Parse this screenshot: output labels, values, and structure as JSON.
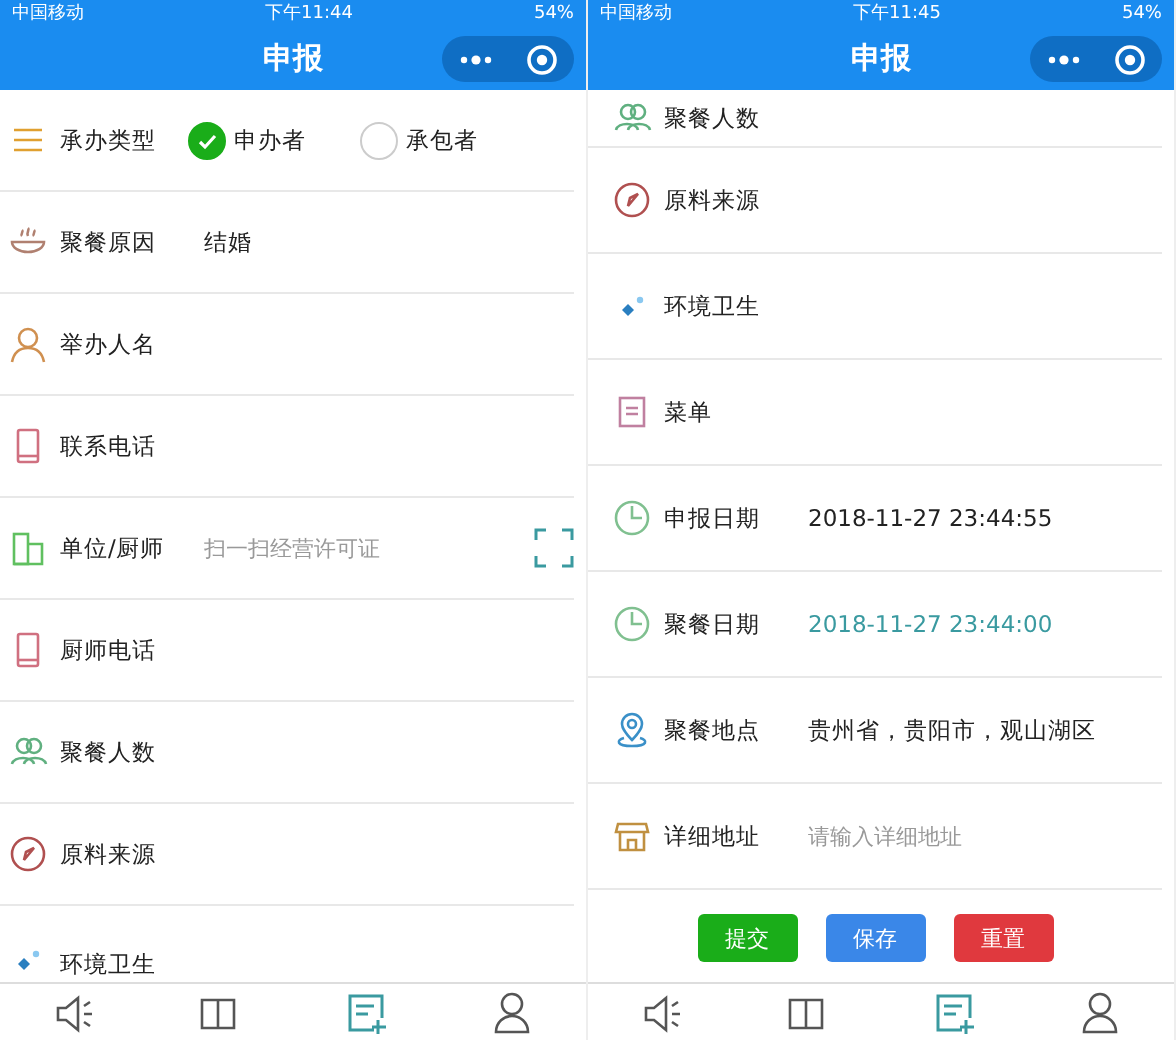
{
  "screens": [
    {
      "status_bar": {
        "carrier": "中国移动",
        "time": "下午11:44",
        "battery": "54%"
      },
      "title": "申报",
      "form_rows": [
        {
          "kind": "radio",
          "label": "承办类型",
          "options": [
            {
              "label": "申办者",
              "selected": true
            },
            {
              "label": "承包者",
              "selected": false
            }
          ]
        },
        {
          "kind": "value",
          "label": "聚餐原因",
          "value": "结婚"
        },
        {
          "kind": "value",
          "label": "举办人名"
        },
        {
          "kind": "value",
          "label": "联系电话"
        },
        {
          "kind": "scan",
          "label": "单位/厨师",
          "placeholder": "扫一扫经营许可证"
        },
        {
          "kind": "value",
          "label": "厨师电话"
        },
        {
          "kind": "value",
          "label": "聚餐人数"
        },
        {
          "kind": "value",
          "label": "原料来源"
        },
        {
          "kind": "value",
          "label": "环境卫生"
        }
      ],
      "tab_bar": [
        {
          "selected": false
        },
        {
          "selected": false
        },
        {
          "selected": true
        },
        {
          "selected": false
        }
      ]
    },
    {
      "status_bar": {
        "carrier": "中国移动",
        "time": "下午11:45",
        "battery": "54%"
      },
      "title": "申报",
      "form_rows": [
        {
          "kind": "value",
          "label": "聚餐人数"
        },
        {
          "kind": "value",
          "label": "原料来源"
        },
        {
          "kind": "value",
          "label": "环境卫生"
        },
        {
          "kind": "value",
          "label": "菜单"
        },
        {
          "kind": "value",
          "label": "申报日期",
          "value": "2018-11-27 23:44:55"
        },
        {
          "kind": "picker",
          "label": "聚餐日期",
          "value": "2018-11-27   23:44:00"
        },
        {
          "kind": "value",
          "label": "聚餐地点",
          "value": "贵州省，贵阳市，观山湖区"
        },
        {
          "kind": "input",
          "label": "详细地址",
          "placeholder": "请输入详细地址"
        }
      ],
      "buttons": [
        {
          "label": "提交",
          "color": "#1aad19"
        },
        {
          "label": "保存",
          "color": "#3a87e8"
        },
        {
          "label": "重置",
          "color": "#e0393e"
        }
      ],
      "tab_bar": [
        {
          "selected": false
        },
        {
          "selected": false
        },
        {
          "selected": true
        },
        {
          "selected": false
        }
      ]
    }
  ]
}
